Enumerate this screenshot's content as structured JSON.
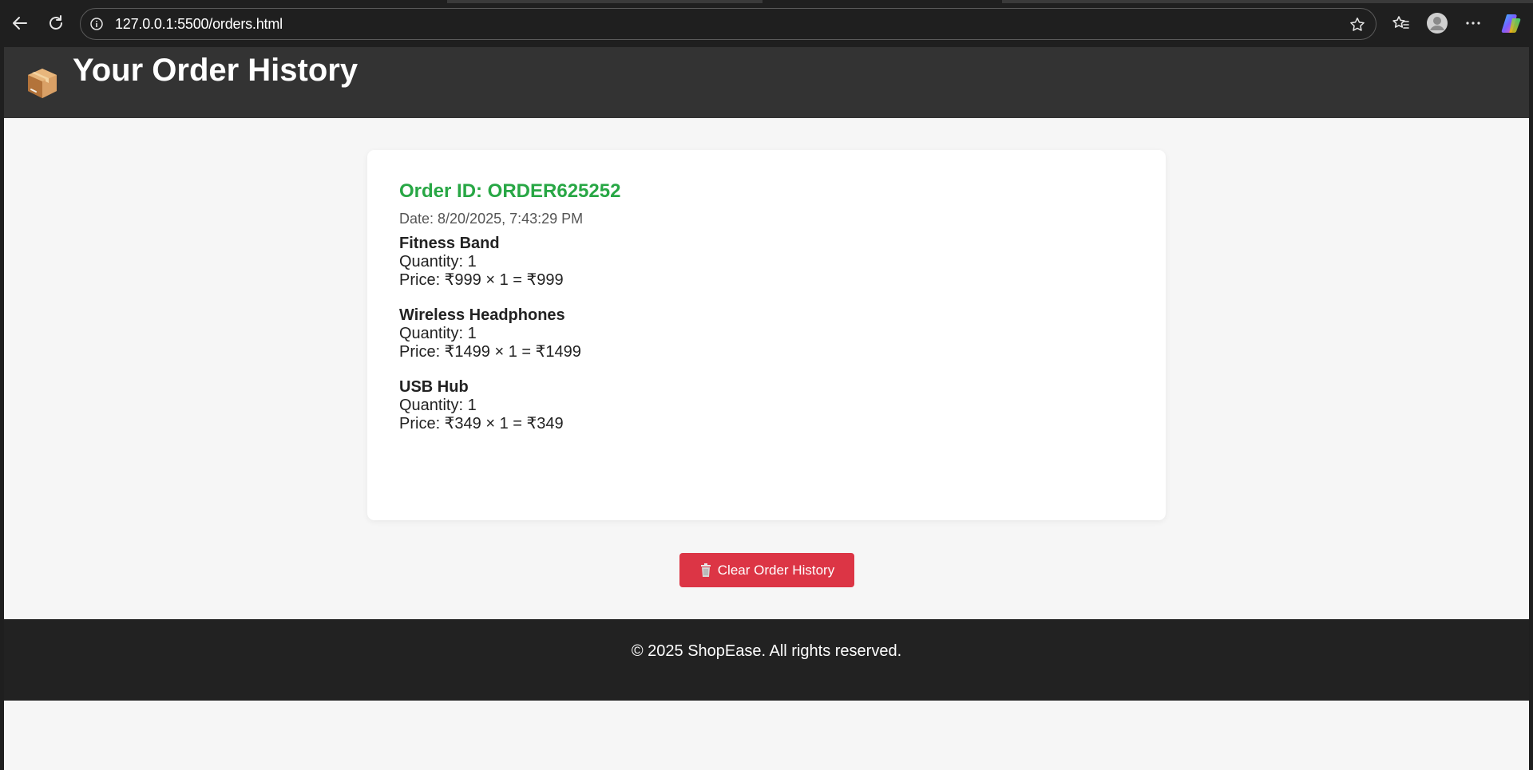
{
  "browser": {
    "url": "127.0.0.1:5500/orders.html",
    "icons": [
      "back-arrow-icon",
      "reload-icon",
      "site-info-icon",
      "favorite-star-icon",
      "favorites-icon",
      "profile-icon",
      "more-icon",
      "copilot-icon"
    ]
  },
  "header": {
    "emoji_icon": "package-box-icon",
    "title": "Your Order History"
  },
  "order": {
    "id_text": "Order ID: ORDER625252",
    "date_text": "Date: 8/20/2025, 7:43:29 PM",
    "items": [
      {
        "name": "Fitness Band",
        "quantity_text": "Quantity: 1",
        "price_text": "Price: ₹999 × 1 = ₹999"
      },
      {
        "name": "Wireless Headphones",
        "quantity_text": "Quantity: 1",
        "price_text": "Price: ₹1499 × 1 = ₹1499"
      },
      {
        "name": "USB Hub",
        "quantity_text": "Quantity: 1",
        "price_text": "Price: ₹349 × 1 = ₹349"
      }
    ]
  },
  "actions": {
    "clear_label": "Clear Order History",
    "clear_icon": "trash-icon"
  },
  "footer": {
    "text": "© 2025 ShopEase. All rights reserved."
  },
  "colors": {
    "header_bg": "#333333",
    "order_id": "#28a745",
    "clear_button": "#dc3545",
    "footer_bg": "#222222",
    "page_bg": "#f6f6f6"
  }
}
